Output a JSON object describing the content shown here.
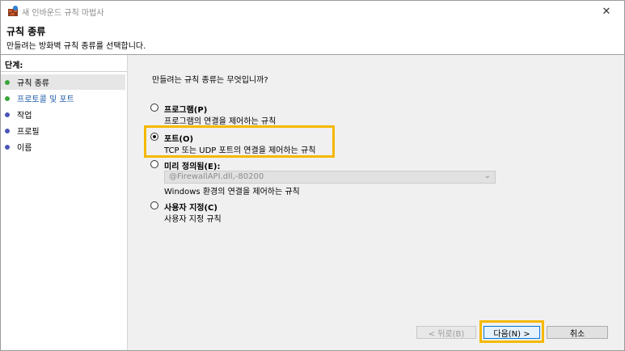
{
  "window": {
    "title": "새 인바운드 규칙 마법사",
    "close_glyph": "✕"
  },
  "header": {
    "title": "규칙 종류",
    "subtitle": "만들려는 방화벽 규칙 종류를 선택합니다."
  },
  "steps": {
    "label": "단계:",
    "items": [
      {
        "label": "규칙 종류",
        "dot_color": "#3aa53a",
        "state": "current"
      },
      {
        "label": "프로토콜 및 포트",
        "dot_color": "#3aa53a",
        "state": "link"
      },
      {
        "label": "작업",
        "dot_color": "#4b55b8",
        "state": "pending"
      },
      {
        "label": "프로필",
        "dot_color": "#4b55b8",
        "state": "pending"
      },
      {
        "label": "이름",
        "dot_color": "#4b55b8",
        "state": "pending"
      }
    ]
  },
  "main": {
    "question": "만들려는 규칙 종류는 무엇입니까?",
    "options": [
      {
        "title": "프로그램(P)",
        "desc": "프로그램의 연결을 제어하는 규칙",
        "checked": false
      },
      {
        "title": "포트(O)",
        "desc": "TCP 또는 UDP 포트의 연결을 제어하는 규칙",
        "checked": true
      },
      {
        "title": "미리 정의됨(E):",
        "desc": "Windows 환경의 연결을 제어하는 규칙",
        "checked": false
      },
      {
        "title": "사용자 지정(C)",
        "desc": "사용자 지정 규칙",
        "checked": false
      }
    ],
    "predefined_combo_value": "@FirewallAPI.dll,-80200",
    "combo_arrow": "⌄"
  },
  "buttons": {
    "back": "< 뒤로(B)",
    "next": "다음(N) >",
    "cancel": "취소"
  },
  "colors": {
    "highlight": "#f5b800",
    "link": "#1c5aa6"
  }
}
